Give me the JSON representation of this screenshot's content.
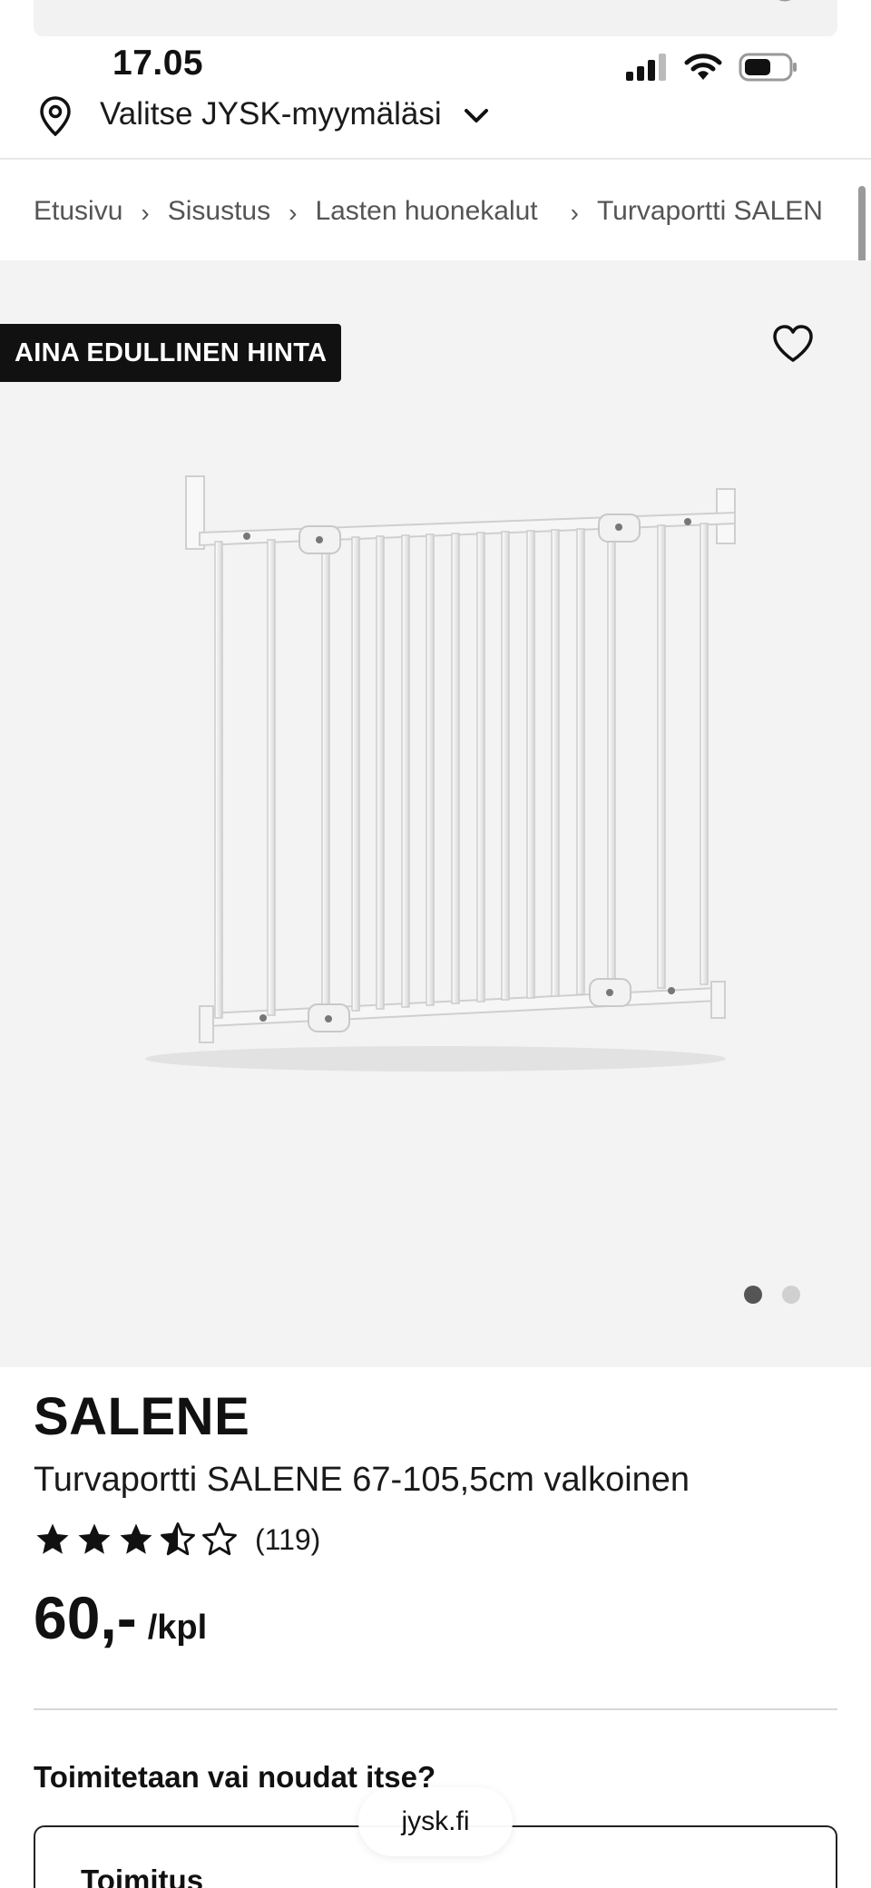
{
  "status_bar": {
    "time": "17.05"
  },
  "store_selector": {
    "label": "Valitse JYSK-myymäläsi"
  },
  "breadcrumb": {
    "items": [
      "Etusivu",
      "Sisustus",
      "Lasten huonekalut",
      "Turvaportti SALEN"
    ]
  },
  "hero": {
    "badge": "AINA EDULLINEN HINTA",
    "image_alt": "Turvaportti SALENE valkoinen",
    "image_count": 2,
    "active_image": 1
  },
  "product": {
    "brand": "SALENE",
    "name": "Turvaportti SALENE 67-105,5cm valkoinen",
    "rating": 3.5,
    "rating_max": 5,
    "review_count": "(119)",
    "price": "60,-",
    "unit": "/kpl"
  },
  "delivery": {
    "heading": "Toimitetaan vai noudat itse?",
    "option_label": "Toimitus"
  },
  "browser": {
    "url": "jysk.fi"
  },
  "colors": {
    "badge_bg": "#111111",
    "hero_bg": "#f3f3f3",
    "text": "#111111"
  }
}
